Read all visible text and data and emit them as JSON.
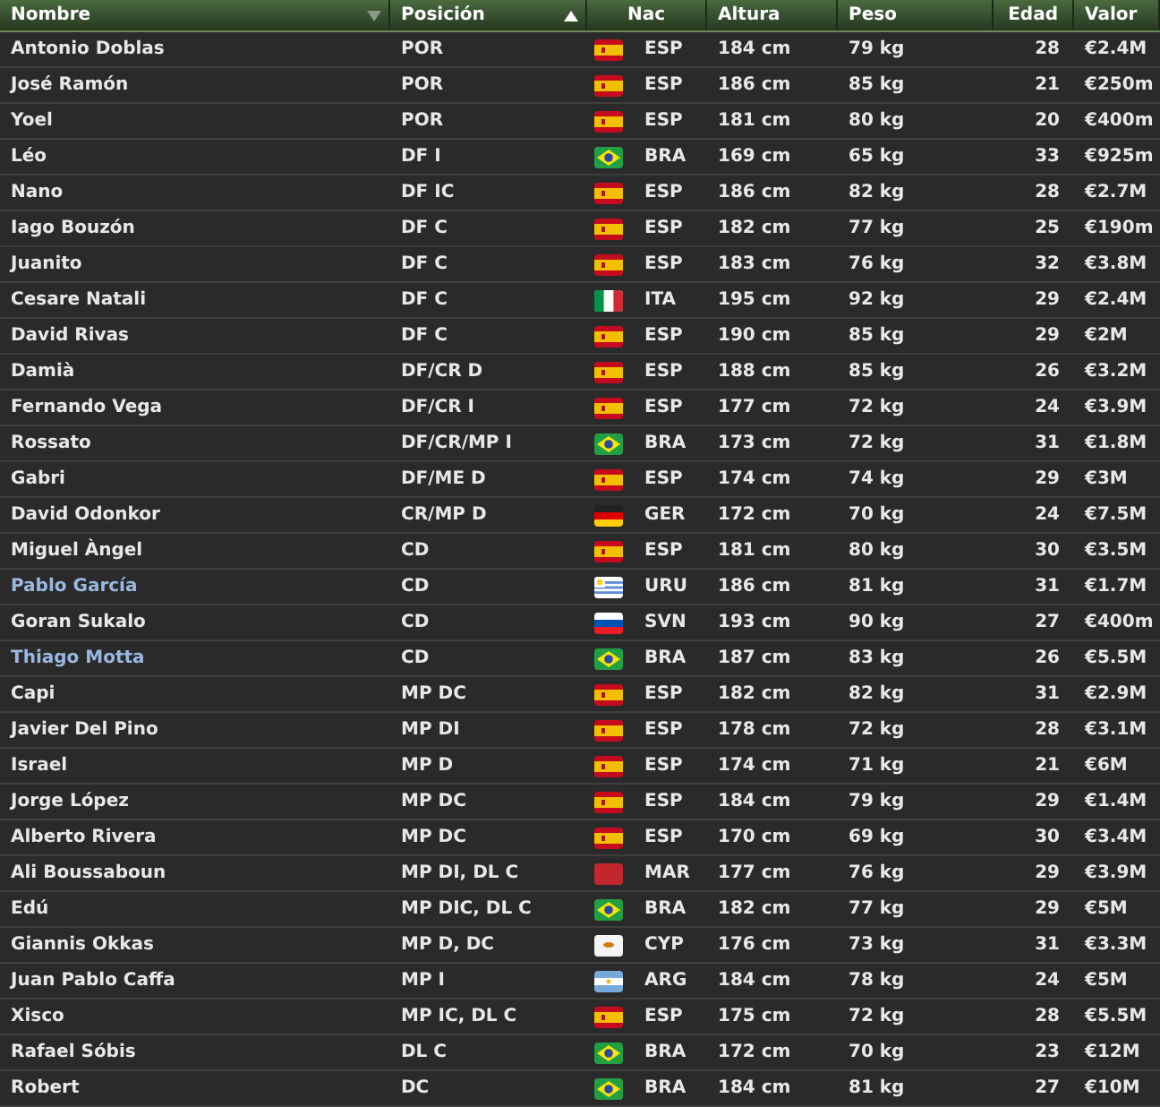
{
  "table": {
    "columns": [
      {
        "label": "Nombre",
        "sort": {
          "kind": "desc"
        }
      },
      {
        "label": "Posición",
        "sort": {
          "kind": "asc"
        }
      },
      {
        "label": "Nac"
      },
      {
        "label": "Altura"
      },
      {
        "label": "Peso"
      },
      {
        "label": "Edad"
      },
      {
        "label": "Valor"
      }
    ],
    "rows": [
      {
        "name": "Antonio Doblas",
        "highlighted": false,
        "position": "POR",
        "flag": {
          "kind": "spain"
        },
        "nation": "ESP",
        "height": "184 cm",
        "weight": "79 kg",
        "age": "28",
        "value": "€2.4M"
      },
      {
        "name": "José Ramón",
        "highlighted": false,
        "position": "POR",
        "flag": {
          "kind": "spain"
        },
        "nation": "ESP",
        "height": "186 cm",
        "weight": "85 kg",
        "age": "21",
        "value": "€250m"
      },
      {
        "name": "Yoel",
        "highlighted": false,
        "position": "POR",
        "flag": {
          "kind": "spain"
        },
        "nation": "ESP",
        "height": "181 cm",
        "weight": "80 kg",
        "age": "20",
        "value": "€400m"
      },
      {
        "name": "Léo",
        "highlighted": false,
        "position": "DF I",
        "flag": {
          "kind": "brazil"
        },
        "nation": "BRA",
        "height": "169 cm",
        "weight": "65 kg",
        "age": "33",
        "value": "€925m"
      },
      {
        "name": "Nano",
        "highlighted": false,
        "position": "DF IC",
        "flag": {
          "kind": "spain"
        },
        "nation": "ESP",
        "height": "186 cm",
        "weight": "82 kg",
        "age": "28",
        "value": "€2.7M"
      },
      {
        "name": "Iago Bouzón",
        "highlighted": false,
        "position": "DF C",
        "flag": {
          "kind": "spain"
        },
        "nation": "ESP",
        "height": "182 cm",
        "weight": "77 kg",
        "age": "25",
        "value": "€190m"
      },
      {
        "name": "Juanito",
        "highlighted": false,
        "position": "DF C",
        "flag": {
          "kind": "spain"
        },
        "nation": "ESP",
        "height": "183 cm",
        "weight": "76 kg",
        "age": "32",
        "value": "€3.8M"
      },
      {
        "name": "Cesare Natali",
        "highlighted": false,
        "position": "DF C",
        "flag": {
          "kind": "italy"
        },
        "nation": "ITA",
        "height": "195 cm",
        "weight": "92 kg",
        "age": "29",
        "value": "€2.4M"
      },
      {
        "name": "David Rivas",
        "highlighted": false,
        "position": "DF C",
        "flag": {
          "kind": "spain"
        },
        "nation": "ESP",
        "height": "190 cm",
        "weight": "85 kg",
        "age": "29",
        "value": "€2M"
      },
      {
        "name": "Damià",
        "highlighted": false,
        "position": "DF/CR D",
        "flag": {
          "kind": "spain"
        },
        "nation": "ESP",
        "height": "188 cm",
        "weight": "85 kg",
        "age": "26",
        "value": "€3.2M"
      },
      {
        "name": "Fernando Vega",
        "highlighted": false,
        "position": "DF/CR I",
        "flag": {
          "kind": "spain"
        },
        "nation": "ESP",
        "height": "177 cm",
        "weight": "72 kg",
        "age": "24",
        "value": "€3.9M"
      },
      {
        "name": "Rossato",
        "highlighted": false,
        "position": "DF/CR/MP I",
        "flag": {
          "kind": "brazil"
        },
        "nation": "BRA",
        "height": "173 cm",
        "weight": "72 kg",
        "age": "31",
        "value": "€1.8M"
      },
      {
        "name": "Gabri",
        "highlighted": false,
        "position": "DF/ME D",
        "flag": {
          "kind": "spain"
        },
        "nation": "ESP",
        "height": "174 cm",
        "weight": "74 kg",
        "age": "29",
        "value": "€3M"
      },
      {
        "name": "David Odonkor",
        "highlighted": false,
        "position": "CR/MP D",
        "flag": {
          "kind": "germany"
        },
        "nation": "GER",
        "height": "172 cm",
        "weight": "70 kg",
        "age": "24",
        "value": "€7.5M"
      },
      {
        "name": "Miguel Àngel",
        "highlighted": false,
        "position": "CD",
        "flag": {
          "kind": "spain"
        },
        "nation": "ESP",
        "height": "181 cm",
        "weight": "80 kg",
        "age": "30",
        "value": "€3.5M"
      },
      {
        "name": "Pablo García",
        "highlighted": true,
        "position": "CD",
        "flag": {
          "kind": "uruguay"
        },
        "nation": "URU",
        "height": "186 cm",
        "weight": "81 kg",
        "age": "31",
        "value": "€1.7M"
      },
      {
        "name": "Goran Sukalo",
        "highlighted": false,
        "position": "CD",
        "flag": {
          "kind": "slovenia"
        },
        "nation": "SVN",
        "height": "193 cm",
        "weight": "90 kg",
        "age": "27",
        "value": "€400m"
      },
      {
        "name": "Thiago Motta",
        "highlighted": true,
        "position": "CD",
        "flag": {
          "kind": "brazil"
        },
        "nation": "BRA",
        "height": "187 cm",
        "weight": "83 kg",
        "age": "26",
        "value": "€5.5M"
      },
      {
        "name": "Capi",
        "highlighted": false,
        "position": "MP DC",
        "flag": {
          "kind": "spain"
        },
        "nation": "ESP",
        "height": "182 cm",
        "weight": "82 kg",
        "age": "31",
        "value": "€2.9M"
      },
      {
        "name": "Javier Del Pino",
        "highlighted": false,
        "position": "MP DI",
        "flag": {
          "kind": "spain"
        },
        "nation": "ESP",
        "height": "178 cm",
        "weight": "72 kg",
        "age": "28",
        "value": "€3.1M"
      },
      {
        "name": "Israel",
        "highlighted": false,
        "position": "MP D",
        "flag": {
          "kind": "spain"
        },
        "nation": "ESP",
        "height": "174 cm",
        "weight": "71 kg",
        "age": "21",
        "value": "€6M"
      },
      {
        "name": "Jorge López",
        "highlighted": false,
        "position": "MP DC",
        "flag": {
          "kind": "spain"
        },
        "nation": "ESP",
        "height": "184 cm",
        "weight": "79 kg",
        "age": "29",
        "value": "€1.4M"
      },
      {
        "name": "Alberto Rivera",
        "highlighted": false,
        "position": "MP DC",
        "flag": {
          "kind": "spain"
        },
        "nation": "ESP",
        "height": "170 cm",
        "weight": "69 kg",
        "age": "30",
        "value": "€3.4M"
      },
      {
        "name": "Ali Boussaboun",
        "highlighted": false,
        "position": "MP DI, DL C",
        "flag": {
          "kind": "morocco"
        },
        "nation": "MAR",
        "height": "177 cm",
        "weight": "76 kg",
        "age": "29",
        "value": "€3.9M"
      },
      {
        "name": "Edú",
        "highlighted": false,
        "position": "MP DIC, DL C",
        "flag": {
          "kind": "brazil"
        },
        "nation": "BRA",
        "height": "182 cm",
        "weight": "77 kg",
        "age": "29",
        "value": "€5M"
      },
      {
        "name": "Giannis Okkas",
        "highlighted": false,
        "position": "MP D, DC",
        "flag": {
          "kind": "cyprus"
        },
        "nation": "CYP",
        "height": "176 cm",
        "weight": "73 kg",
        "age": "31",
        "value": "€3.3M"
      },
      {
        "name": "Juan Pablo Caffa",
        "highlighted": false,
        "position": "MP I",
        "flag": {
          "kind": "argentina"
        },
        "nation": "ARG",
        "height": "184 cm",
        "weight": "78 kg",
        "age": "24",
        "value": "€5M"
      },
      {
        "name": "Xisco",
        "highlighted": false,
        "position": "MP IC, DL C",
        "flag": {
          "kind": "spain"
        },
        "nation": "ESP",
        "height": "175 cm",
        "weight": "72 kg",
        "age": "28",
        "value": "€5.5M"
      },
      {
        "name": "Rafael Sóbis",
        "highlighted": false,
        "position": "DL C",
        "flag": {
          "kind": "brazil"
        },
        "nation": "BRA",
        "height": "172 cm",
        "weight": "70 kg",
        "age": "23",
        "value": "€12M"
      },
      {
        "name": "Robert",
        "highlighted": false,
        "position": "DC",
        "flag": {
          "kind": "brazil"
        },
        "nation": "BRA",
        "height": "184 cm",
        "weight": "81 kg",
        "age": "27",
        "value": "€10M"
      }
    ]
  }
}
